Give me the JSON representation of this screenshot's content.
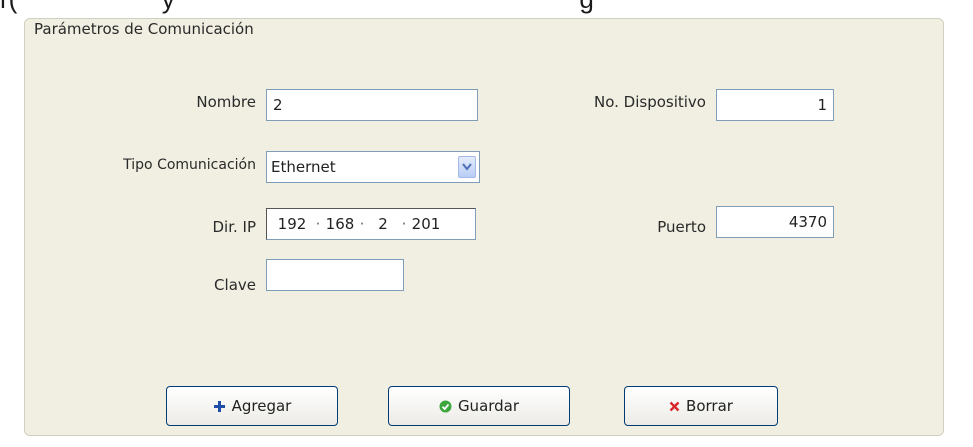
{
  "page_fragment": "r(                    y                                                        g",
  "panel": {
    "legend": "Parámetros de Comunicación"
  },
  "fields": {
    "nombre": {
      "label": "Nombre",
      "value": "2"
    },
    "no_dispositivo": {
      "label": "No. Dispositivo",
      "value": "1"
    },
    "tipo_comunicacion": {
      "label": "Tipo Comunicación",
      "value": "Ethernet"
    },
    "dir_ip": {
      "label": "Dir. IP",
      "octets": [
        "192",
        "168",
        "2",
        "201"
      ]
    },
    "puerto": {
      "label": "Puerto",
      "value": "4370"
    },
    "clave": {
      "label": "Clave",
      "value": ""
    }
  },
  "buttons": {
    "agregar": {
      "label": "Agregar",
      "icon": "plus-icon",
      "color": "#1f4ea8"
    },
    "guardar": {
      "label": "Guardar",
      "icon": "check-circle-icon",
      "color": "#3da63d"
    },
    "borrar": {
      "label": "Borrar",
      "icon": "x-icon",
      "color": "#d8262d"
    }
  }
}
